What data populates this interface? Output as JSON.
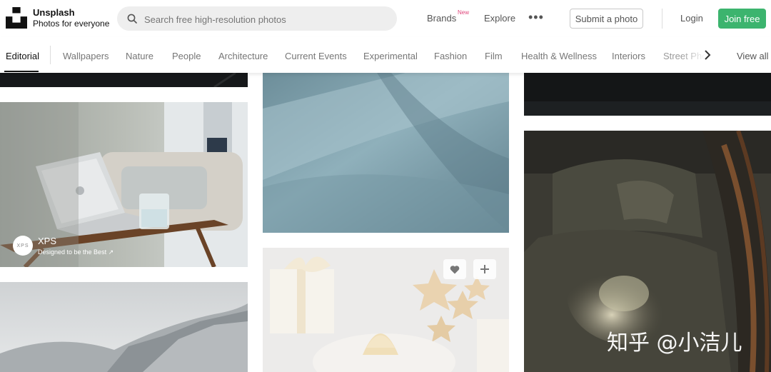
{
  "brand": {
    "title": "Unsplash",
    "subtitle": "Photos for everyone",
    "logo_icon": "unsplash-logo-icon"
  },
  "search": {
    "placeholder": "Search free high-resolution photos",
    "icon": "search-icon"
  },
  "nav": {
    "brands": "Brands",
    "brands_badge": "New",
    "explore": "Explore",
    "more": "•••"
  },
  "actions": {
    "submit": "Submit a photo",
    "login": "Login",
    "join": "Join free"
  },
  "topics": {
    "items": [
      "Editorial",
      "Wallpapers",
      "Nature",
      "People",
      "Architecture",
      "Current Events",
      "Experimental",
      "Fashion",
      "Film",
      "Health & Wellness",
      "Interiors"
    ],
    "active": "Editorial",
    "partial": "Street Photo",
    "view_all": "View all",
    "next_icon": "chevron-right-icon"
  },
  "sponsored": {
    "brand": "XPS",
    "tagline": "Designed to be the Best ↗",
    "badge_text": "XPS"
  },
  "photo_actions": {
    "like_icon": "heart-icon",
    "add_icon": "plus-icon"
  },
  "watermark": "知乎 @小洁儿",
  "colors": {
    "join_button": "#3cb46e",
    "new_badge": "#e0457b"
  }
}
